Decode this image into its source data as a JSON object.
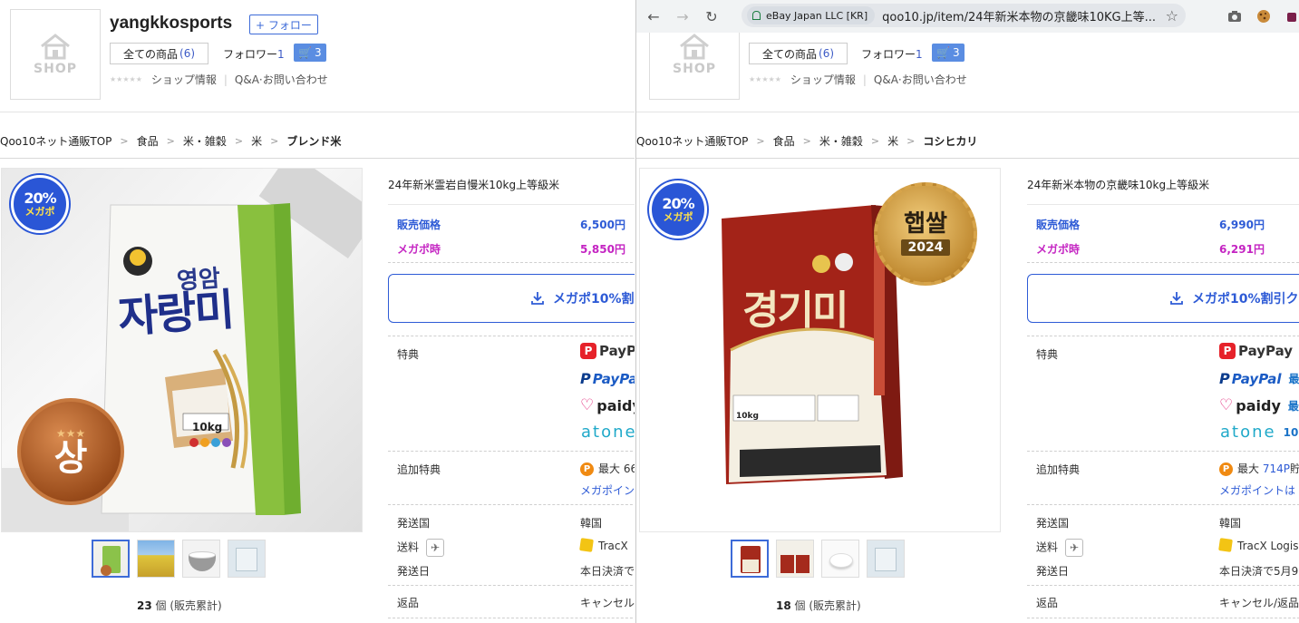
{
  "left": {
    "shop": {
      "name": "yangkkosports",
      "logo_text": "SHOP",
      "follow_label": "+ フォロー",
      "all_products_label": "全ての商品",
      "all_products_count": "(6)",
      "followers_label": "フォロワー",
      "followers_count": "1",
      "cart_count": "3",
      "shop_info": "ショップ情報",
      "qa": "Q&A·お問い合わせ"
    },
    "breadcrumb": [
      "Qoo10ネット通販TOP",
      "食品",
      "米・雑穀",
      "米",
      "ブレンド米"
    ],
    "product": {
      "mega_badge_pct": "20%",
      "mega_badge_label": "メガポ",
      "bag_brand": "영암",
      "bag_name": "자랑미",
      "bag_weight": "10kg",
      "medal": "상",
      "sold_count": "23",
      "sold_unit": "個 (販売累計)",
      "title": "24年新米霊岩自慢米10kg上等級米",
      "price_label": "販売価格",
      "price": "6,500円",
      "mega_label": "メガポ時",
      "mega_price": "5,850円",
      "coupon_label": "メガポ10%割",
      "perk_label": "特典",
      "pay": [
        "PayPay",
        "PayPal",
        "paidy",
        "atone"
      ],
      "extra_perk_label": "追加特典",
      "extra_perk_value": "最大 66",
      "extra_perk_link": "メガポイント",
      "ship_country_label": "発送国",
      "ship_country": "韓国",
      "shipping_label": "送料",
      "shipping_value": "TracX",
      "ship_date_label": "発送日",
      "ship_date": "本日決済で",
      "return_label": "返品",
      "return_value": "キャンセル"
    }
  },
  "right": {
    "browser": {
      "site_chip": "eBay Japan LLC [KR]",
      "url": "qoo10.jp/item/24年新米本物の京畿味10KG上等..."
    },
    "shop": {
      "logo_text": "SHOP",
      "all_products_label": "全ての商品",
      "all_products_count": "(6)",
      "followers_label": "フォロワー",
      "followers_count": "1",
      "cart_count": "3",
      "shop_info": "ショップ情報",
      "qa": "Q&A·お問い合わせ"
    },
    "breadcrumb": [
      "Qoo10ネット通販TOP",
      "食品",
      "米・雑穀",
      "米",
      "コシヒカリ"
    ],
    "product": {
      "mega_badge_pct": "20%",
      "mega_badge_label": "メガポ",
      "bag_name": "경기미",
      "bag_weight": "10kg",
      "medal_top": "햅쌀",
      "medal_year": "2024",
      "sold_count": "18",
      "sold_unit": "個 (販売累計)",
      "title": "24年新米本物の京畿味10kg上等級米",
      "price_label": "販売価格",
      "price": "6,990円",
      "mega_label": "メガポ時",
      "mega_price": "6,291円",
      "coupon_label": "メガポ10%割引ク",
      "perk_label": "特典",
      "pay": [
        "PayPay",
        "PayPal",
        "paidy",
        "atone"
      ],
      "pay_suffix": [
        "最",
        "最",
        "最",
        "10"
      ],
      "extra_perk_label": "追加特典",
      "extra_perk_value": "最大",
      "extra_perk_points": "714P",
      "extra_perk_suffix": "貯",
      "extra_perk_link": "メガポイントは",
      "ship_country_label": "発送国",
      "ship_country": "韓国",
      "shipping_label": "送料",
      "shipping_value": "TracX Logis",
      "ship_date_label": "発送日",
      "ship_date": "本日決済で5月9",
      "return_label": "返品",
      "return_value": "キャンセル/返品"
    }
  }
}
